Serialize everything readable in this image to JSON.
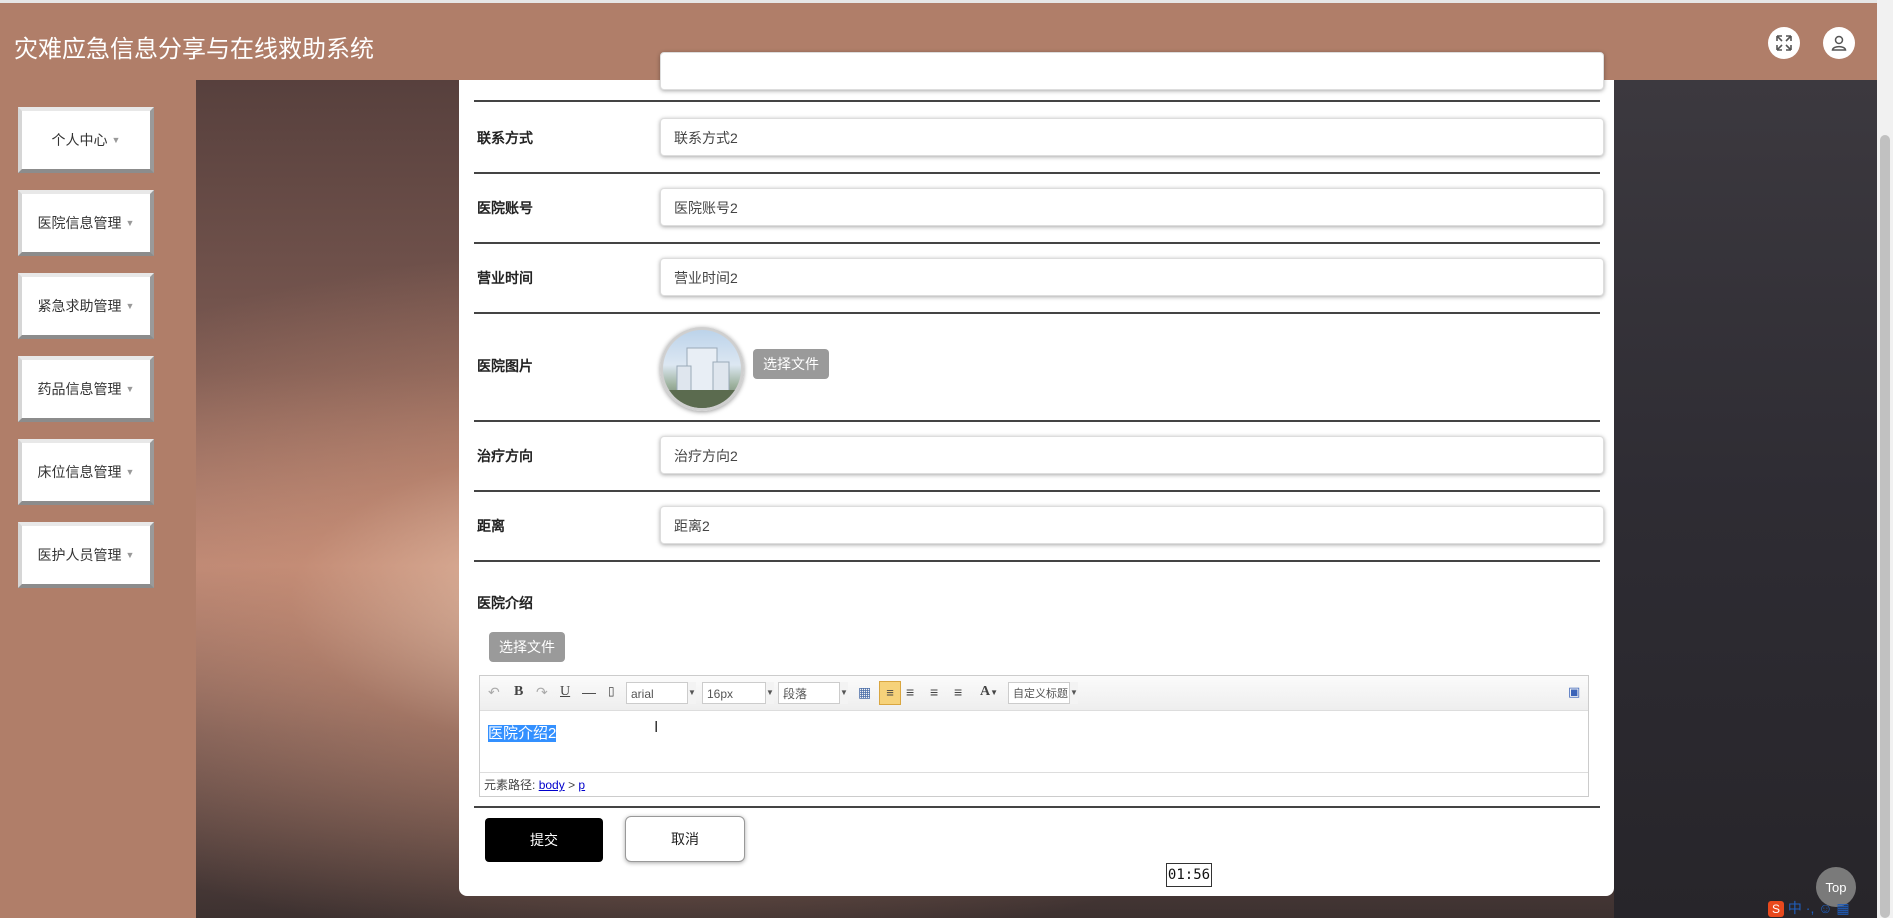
{
  "header": {
    "title": "灾难应急信息分享与在线救助系统"
  },
  "sidebar": {
    "items": [
      {
        "label": "个人中心"
      },
      {
        "label": "医院信息管理"
      },
      {
        "label": "紧急求助管理"
      },
      {
        "label": "药品信息管理"
      },
      {
        "label": "床位信息管理"
      },
      {
        "label": "医护人员管理"
      }
    ]
  },
  "form": {
    "fields": [
      {
        "label": "联系方式",
        "value": "联系方式2"
      },
      {
        "label": "医院账号",
        "value": "医院账号2"
      },
      {
        "label": "营业时间",
        "value": "营业时间2"
      },
      {
        "label": "治疗方向",
        "value": "治疗方向2"
      },
      {
        "label": "距离",
        "value": "距离2"
      }
    ],
    "image_label": "医院图片",
    "choose_file": "选择文件",
    "intro_label": "医院介绍",
    "intro_choose_file": "选择文件",
    "editor": {
      "font_family": "arial",
      "font_size": "16px",
      "paragraph": "段落",
      "custom_title": "自定义标题",
      "content": "医院介绍2",
      "path_label": "元素路径:",
      "path_body": "body",
      "path_sep": ">",
      "path_p": "p"
    },
    "submit_label": "提交",
    "cancel_label": "取消"
  },
  "overlay": {
    "timer": "01:56",
    "top_label": "Top",
    "ime": "中 ·, ☺ ▦"
  }
}
